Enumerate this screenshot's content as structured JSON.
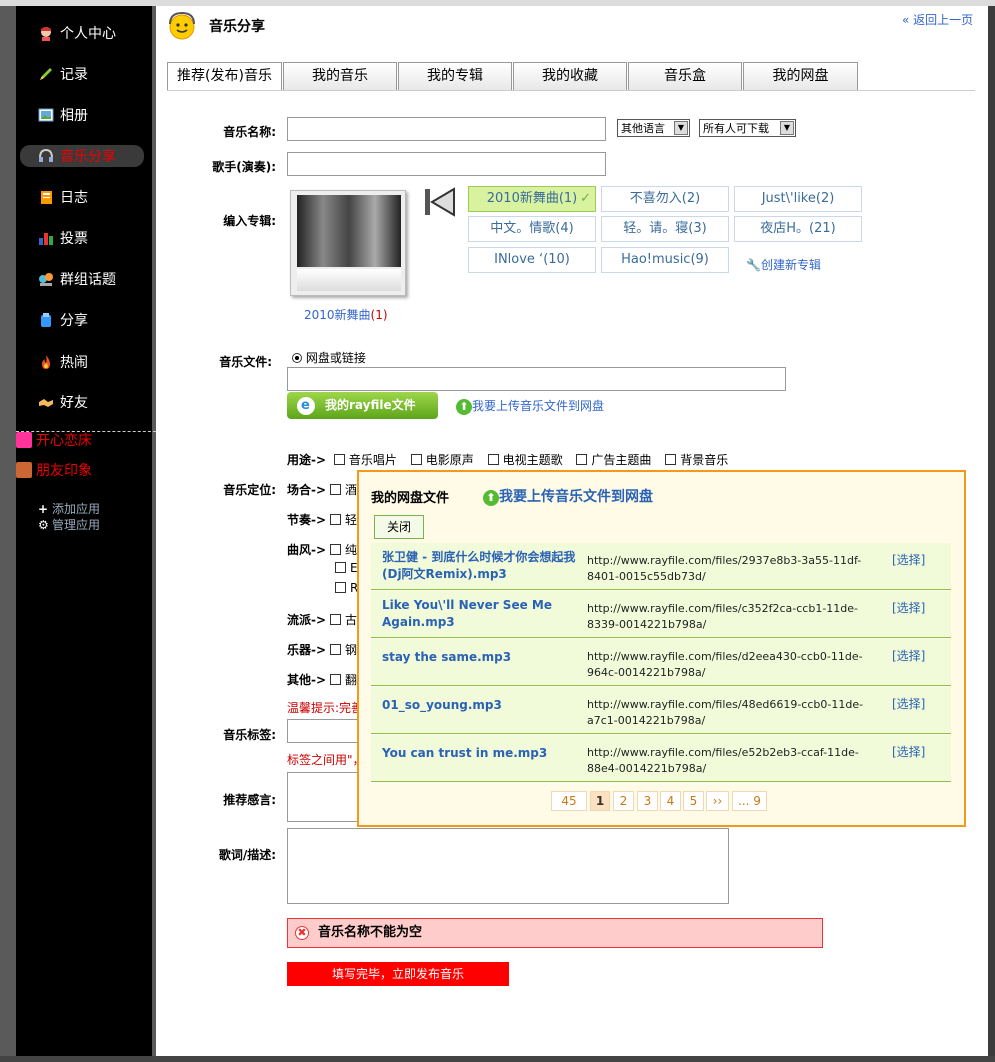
{
  "sidebar": {
    "items": [
      {
        "label": "个人中心",
        "icon": "avatar-icon"
      },
      {
        "label": "记录",
        "icon": "pencil-icon"
      },
      {
        "label": "相册",
        "icon": "photo-icon"
      },
      {
        "label": "音乐分享",
        "icon": "headphones-icon"
      },
      {
        "label": "日志",
        "icon": "notebook-icon"
      },
      {
        "label": "投票",
        "icon": "bar-chart-icon"
      },
      {
        "label": "群组话题",
        "icon": "group-icon"
      },
      {
        "label": "分享",
        "icon": "share-icon"
      },
      {
        "label": "热闹",
        "icon": "fire-icon"
      },
      {
        "label": "好友",
        "icon": "handshake-icon"
      }
    ],
    "extras": [
      {
        "label": "开心恋床"
      },
      {
        "label": "朋友印象"
      }
    ],
    "add_app": "添加应用",
    "manage_app": "管理应用"
  },
  "header": {
    "title": "音乐分享",
    "back_link": "« 返回上一页"
  },
  "tabs": [
    "推荐(发布)音乐",
    "我的音乐",
    "我的专辑",
    "我的收藏",
    "音乐盒",
    "我的网盘"
  ],
  "form": {
    "music_name_label": "音乐名称:",
    "music_name_value": "",
    "language_select": "其他语言",
    "download_select": "所有人可下载",
    "singer_label": "歌手(演奏):",
    "album_label": "编入专辑:",
    "album_cover_caption": "2010新舞曲",
    "album_cover_count": "(1)",
    "albums": [
      "2010新舞曲(1)",
      "不喜勿入(2)",
      "Just\\'like(2)",
      "中文。情歌(4)",
      "轻。请。寝(3)",
      "夜店H。(21)",
      "INlove ‘(10)",
      "Hao!music(9)"
    ],
    "create_album": "创建新专辑",
    "file_label": "音乐文件:",
    "file_radio": "网盘或链接",
    "rayfile_button": "我的rayfile文件",
    "upload_link": "我要上传音乐文件到网盘",
    "position_label": "音乐定位:",
    "usage_label": "用途->",
    "usage_options": [
      "音乐唱片",
      "电影原声",
      "电视主题歌",
      "广告主题曲",
      "背景音乐"
    ],
    "scene_label": "场合->",
    "scene_first": "酒",
    "rhythm_label": "节奏->",
    "rhythm_first": "轻",
    "style_label": "曲风->",
    "style_first": "纯",
    "style_row2": "E",
    "style_row3": "R",
    "school_label": "流派->",
    "school_first": "古",
    "instrument_label": "乐器->",
    "instrument_first": "钢",
    "other_label": "其他->",
    "other_first": "翻",
    "tip": "温馨提示:完善",
    "tags_label": "音乐标签:",
    "tags_hint": "标签之间用\"，",
    "recommend_label": "推荐感言:",
    "lyrics_label": "歌词/描述:",
    "error_text": "音乐名称不能为空",
    "submit_button": "填写完毕，立即发布音乐"
  },
  "popup": {
    "title": "我的网盘文件",
    "upload_link": "我要上传音乐文件到网盘",
    "close_button": "关闭",
    "files": [
      {
        "name": "张卫健 - 到底什么时候才你会想起我(Dj阿文Remix).mp3",
        "url": "http://www.rayfile.com/files/2937e8b3-3a55-11df-8401-0015c55db73d/",
        "action": "[选择]"
      },
      {
        "name": "Like You\\'ll Never See Me Again.mp3",
        "url": "http://www.rayfile.com/files/c352f2ca-ccb1-11de-8339-0014221b798a/",
        "action": "[选择]"
      },
      {
        "name": "stay the same.mp3",
        "url": "http://www.rayfile.com/files/d2eea430-ccb0-11de-964c-0014221b798a/",
        "action": "[选择]"
      },
      {
        "name": "01_so_young.mp3",
        "url": "http://www.rayfile.com/files/48ed6619-ccb0-11de-a7c1-0014221b798a/",
        "action": "[选择]"
      },
      {
        "name": "You can trust in me.mp3",
        "url": "http://www.rayfile.com/files/e52b2eb3-ccaf-11de-88e4-0014221b798a/",
        "action": "[选择]"
      }
    ],
    "pagination": {
      "total": "45",
      "pages": [
        "1",
        "2",
        "3",
        "4",
        "5"
      ],
      "next": "››",
      "last": "... 9"
    }
  }
}
